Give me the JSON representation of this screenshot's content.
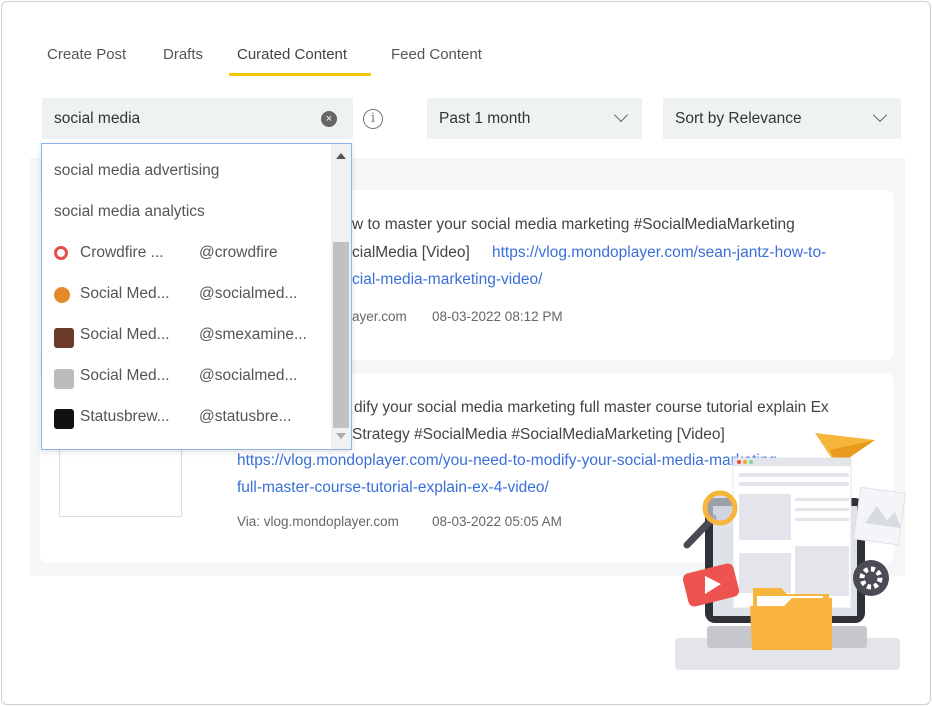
{
  "tabs": [
    {
      "label": "Create Post"
    },
    {
      "label": "Drafts"
    },
    {
      "label": "Curated Content",
      "active": true
    },
    {
      "label": "Feed Content"
    }
  ],
  "search": {
    "value": "social media",
    "clear_icon": "×",
    "info_icon": "i"
  },
  "filters": {
    "date_range": "Past 1 month",
    "sort": "Sort by Relevance"
  },
  "dropdown": {
    "suggestions": [
      "social media advertising",
      "social media analytics"
    ],
    "accounts": [
      {
        "name": "Crowdfire ...",
        "handle": "@crowdfire",
        "color": "#e94a4a"
      },
      {
        "name": "Social Med...",
        "handle": "@socialmed...",
        "color": "#e58a2b"
      },
      {
        "name": "Social Med...",
        "handle": "@smexamine...",
        "color": "#6b3a2a"
      },
      {
        "name": "Social Med...",
        "handle": "@socialmed...",
        "color": "#999999"
      },
      {
        "name": "Statusbrew...",
        "handle": "@statusbre...",
        "color": "#111111"
      }
    ]
  },
  "posts": [
    {
      "line1": "w to master your social media marketing #SocialMediaMarketing",
      "line2": "cialMedia [Video]",
      "link1": "https://vlog.mondoplayer.com/sean-jantz-how-to-",
      "link2": "cial-media-marketing-video/",
      "via": "ayer.com",
      "date": "08-03-2022 08:12 PM"
    },
    {
      "line1": "dify your social media marketing full master course tutorial explain Ex",
      "line2": "Strategy #SocialMedia #SocialMediaMarketing [Video]",
      "link1": "https://vlog.mondoplayer.com/you-need-to-modify-your-social-media-marketing-",
      "link2": "full-master-course-tutorial-explain-ex-4-video/",
      "via": "Via: vlog.mondoplayer.com",
      "date": "08-03-2022 05:05 AM"
    }
  ],
  "colors": {
    "accent": "#f5c400",
    "link": "#3a6fd8",
    "dropdown_border": "#8fb4ec"
  }
}
